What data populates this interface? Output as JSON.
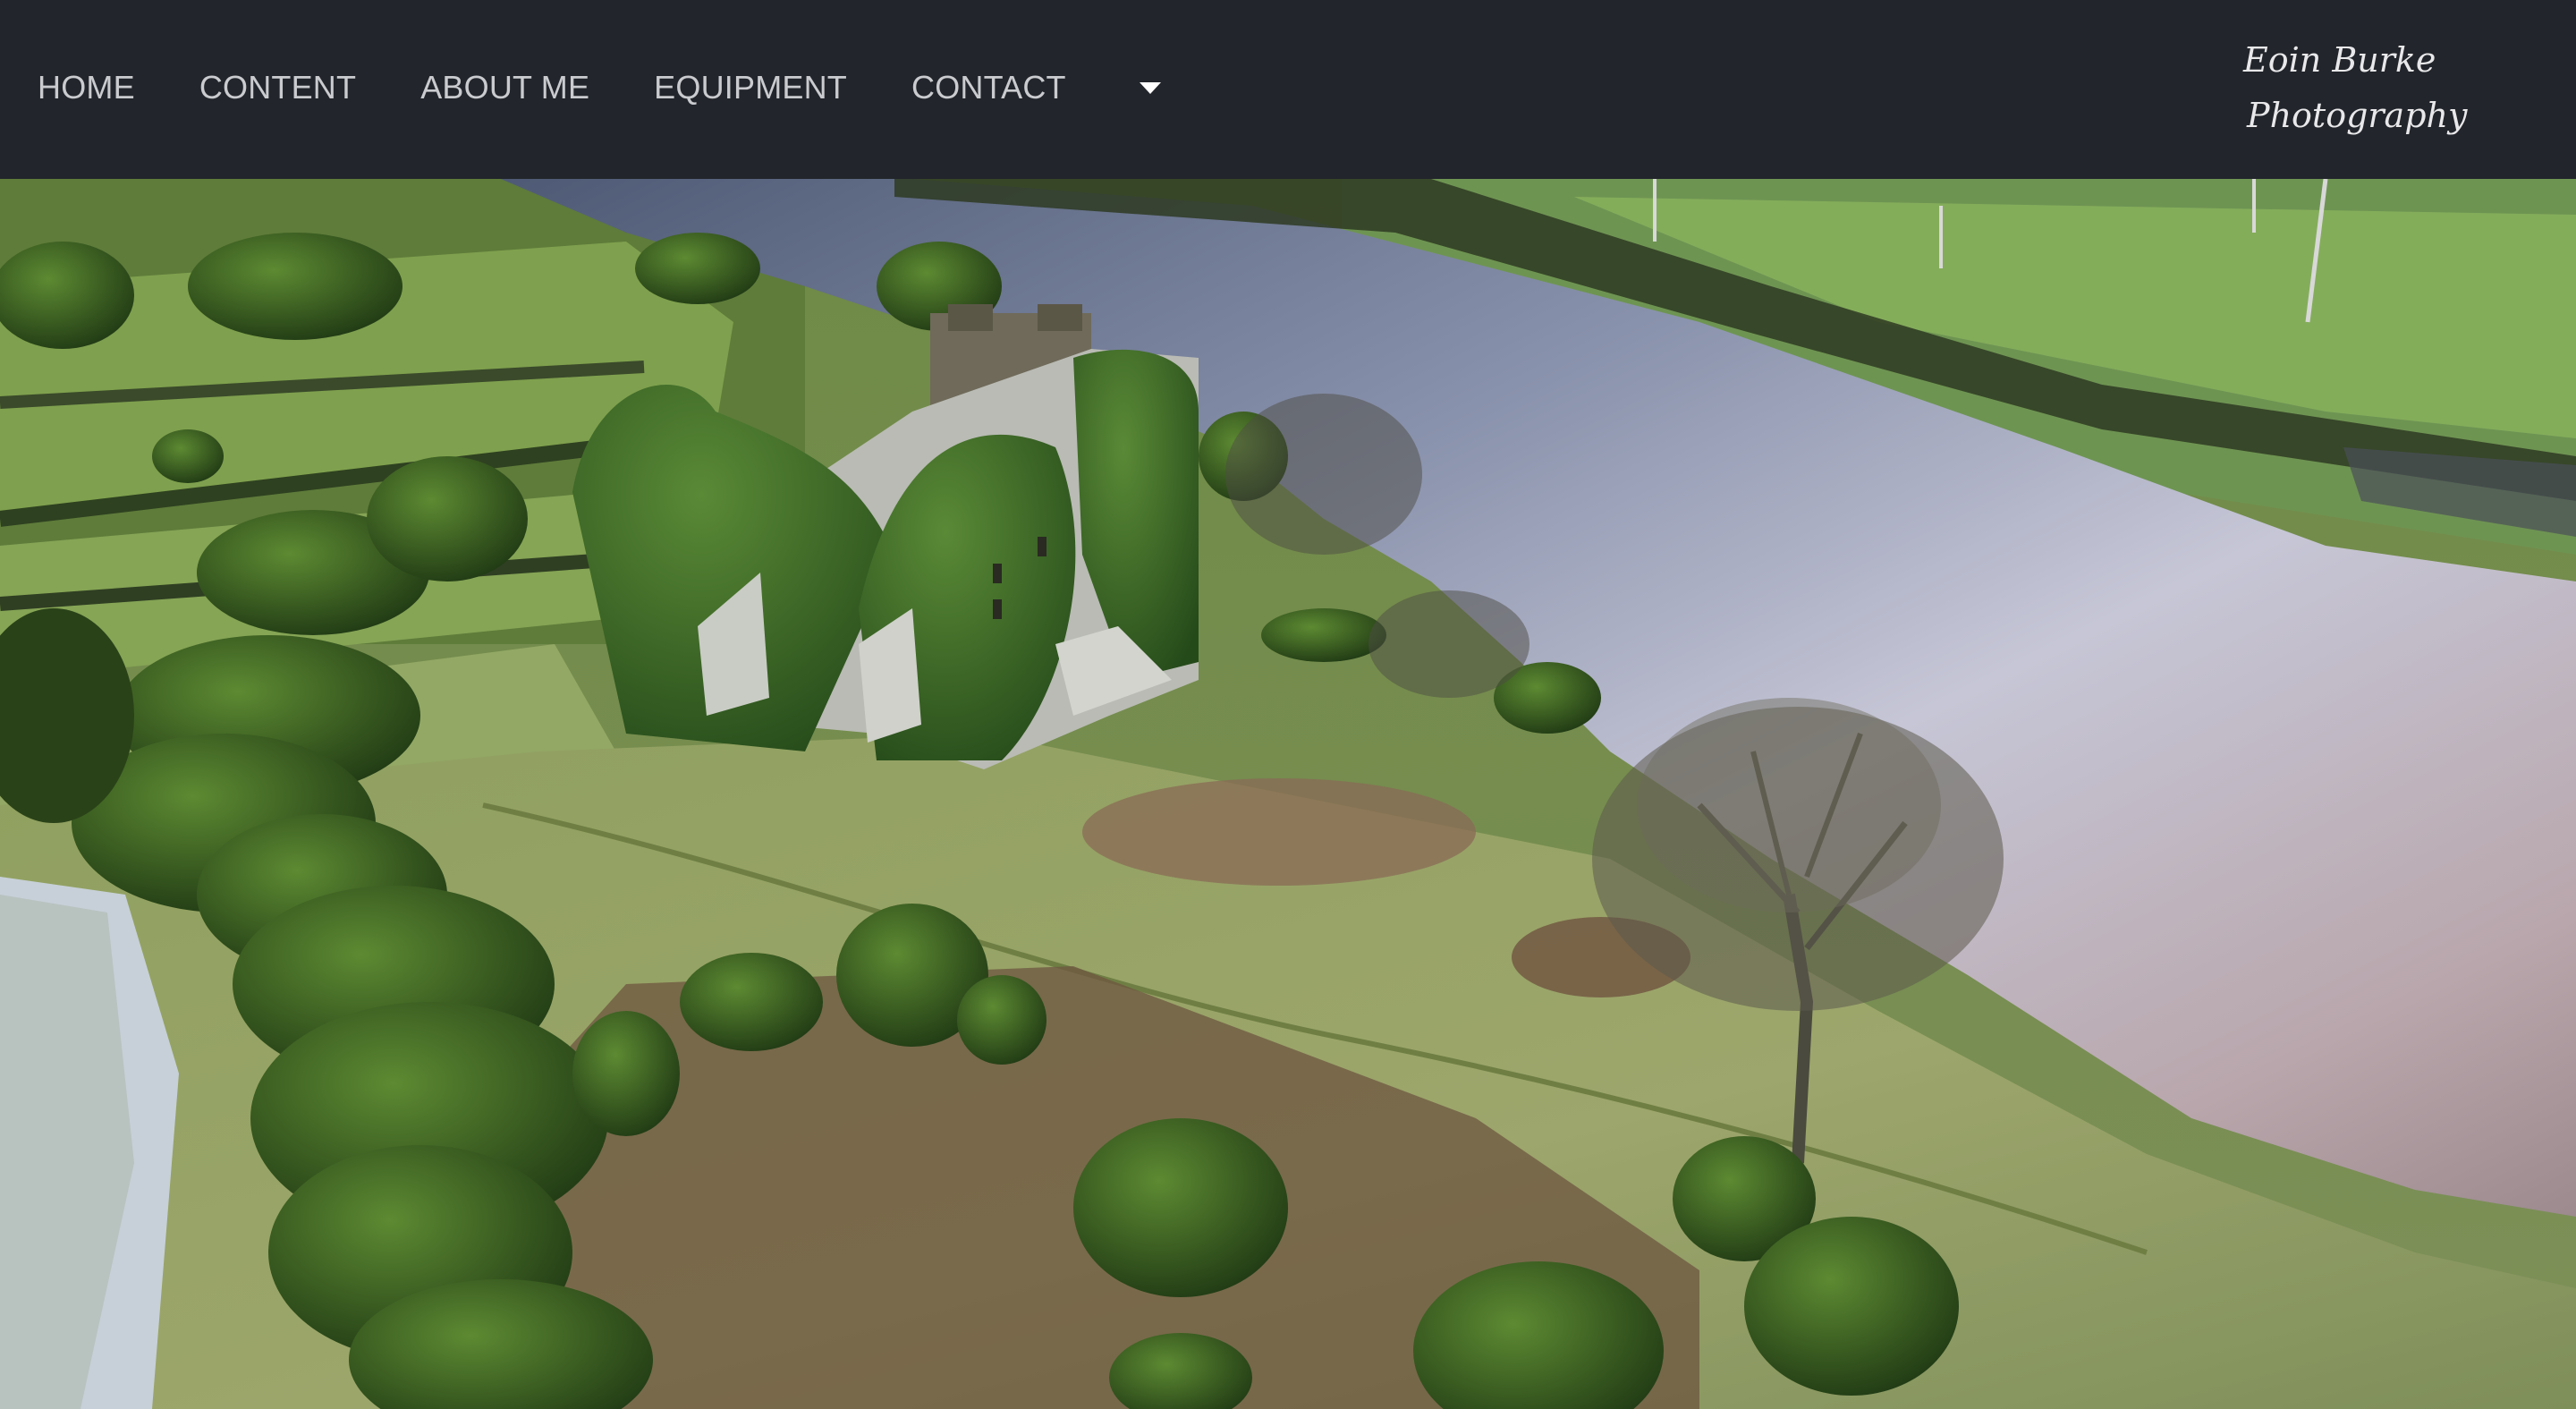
{
  "nav": {
    "items": [
      {
        "label": "HOME"
      },
      {
        "label": "CONTENT"
      },
      {
        "label": "ABOUT ME"
      },
      {
        "label": "EQUIPMENT"
      },
      {
        "label": "CONTACT"
      }
    ],
    "dropdown_icon": "caret-down-icon"
  },
  "brand": {
    "line1": "Eoin Burke",
    "line2": "Photography"
  },
  "hero": {
    "subject": "aerial photo of ivy-covered castle ruin beside a river"
  },
  "colors": {
    "navbar_bg": "#22252b",
    "nav_text": "#c9cbcf",
    "brand_text": "#e8e8ea"
  }
}
